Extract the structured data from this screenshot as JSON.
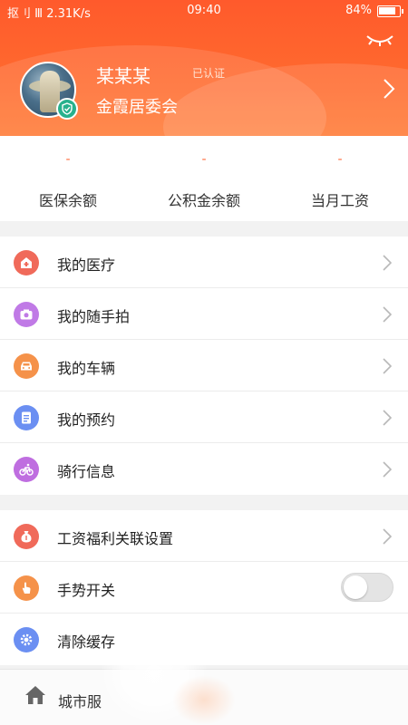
{
  "status_bar": {
    "signal": "抠刂 Ⅲ 2.31K/s",
    "time": "09:40",
    "battery": "84%"
  },
  "profile": {
    "name": "某某某",
    "verified": "已认证",
    "organization": "金霞居委会"
  },
  "stats": [
    {
      "value": "-",
      "label": "医保余额"
    },
    {
      "value": "-",
      "label": "公积金余额"
    },
    {
      "value": "-",
      "label": "当月工资"
    }
  ],
  "menu_group_1": [
    {
      "label": "我的医疗",
      "icon": "hospital-icon",
      "color": "#f06a5a"
    },
    {
      "label": "我的随手拍",
      "icon": "camera-icon",
      "color": "#c07ae6"
    },
    {
      "label": "我的车辆",
      "icon": "car-icon",
      "color": "#f5924a"
    },
    {
      "label": "我的预约",
      "icon": "document-icon",
      "color": "#6b8ff2"
    },
    {
      "label": "骑行信息",
      "icon": "bicycle-icon",
      "color": "#bf6ee0"
    }
  ],
  "menu_group_2": [
    {
      "label": "工资福利关联设置",
      "icon": "money-bag-icon",
      "color": "#f06a5a"
    },
    {
      "label": "手势开关",
      "icon": "hand-icon",
      "color": "#f5924a",
      "toggle": false
    },
    {
      "label": "清除缓存",
      "icon": "gear-icon",
      "color": "#6b8ff2"
    }
  ],
  "tabbar": {
    "home_label": "城市服"
  },
  "colors": {
    "header": "#ff6a2e",
    "stat_value": "#ff6b3c",
    "verified_badge": "#27b18d"
  }
}
